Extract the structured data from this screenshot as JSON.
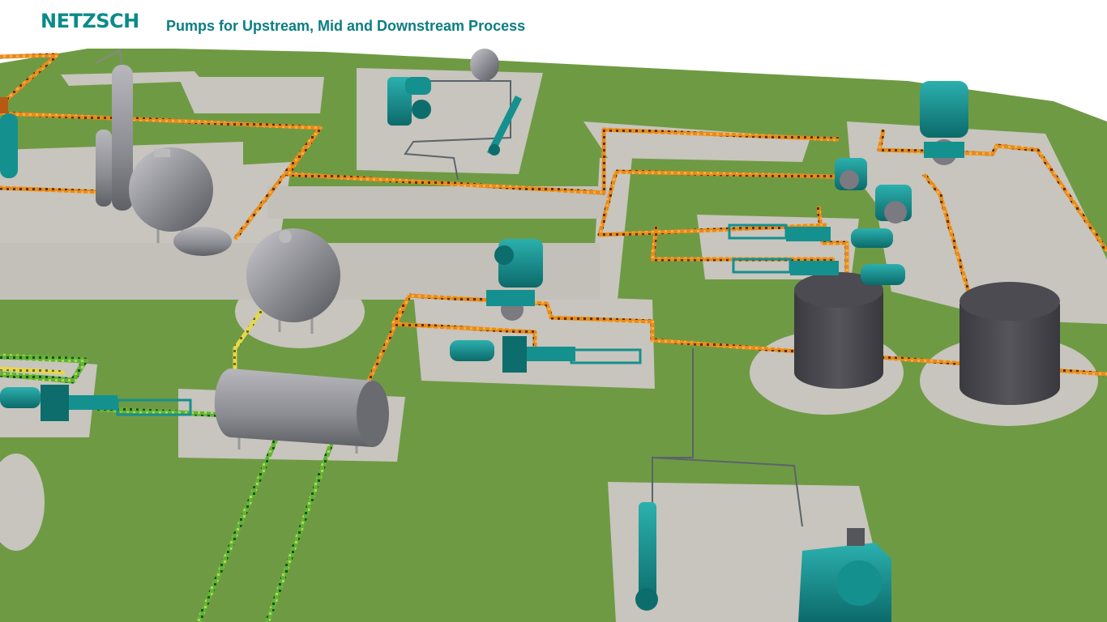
{
  "header": {
    "logo_text": "NETZSCH",
    "title": "Pumps for Upstream, Mid and Downstream Process"
  },
  "scene": {
    "colors": {
      "ground": "#6f9a44",
      "pad": "#c9c7c0",
      "pump_body": "#14908f",
      "pump_dark": "#0d6d6c",
      "tank": "#9a9aa0",
      "tank_dark": "#55555c",
      "storage_tank": "#45454b",
      "pipe_hot": "#e07d17",
      "pipe_green": "#4c9d30",
      "pipe_yellow": "#d8c838",
      "pipe_grey": "#606a70"
    },
    "icons": [
      "vertical-pump-icon",
      "horizontal-progressive-cavity-pump-icon",
      "spherical-tank-icon",
      "horizontal-tank-icon",
      "storage-tank-icon",
      "distillation-column-icon"
    ]
  }
}
